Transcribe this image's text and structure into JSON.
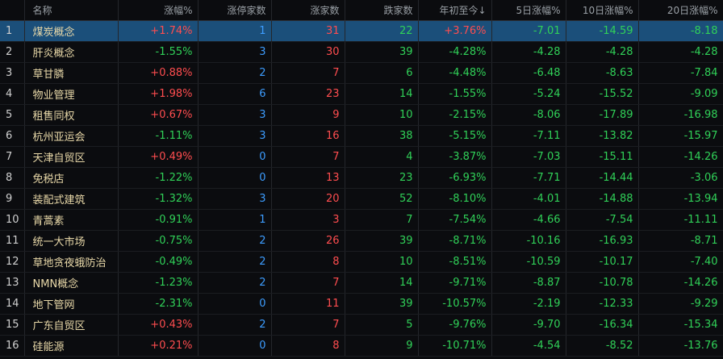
{
  "columns": [
    "",
    "名称",
    "涨幅%",
    "涨停家数",
    "涨家数",
    "跌家数",
    "年初至今↓",
    "5日涨幅%",
    "10日涨幅%",
    "20日涨幅%"
  ],
  "colors": {
    "up": "#ff4d4f",
    "down": "#30d158",
    "limit_up_count": "#3d9dff",
    "name": "#e8d8a8",
    "selected_row_bg": "#1b4f7a"
  },
  "selected_row": 0,
  "rows": [
    {
      "idx": "1",
      "name": "煤炭概念",
      "pct": "+1.74%",
      "limit_up": "1",
      "up_count": "31",
      "down_count": "22",
      "ytd": "+3.76%",
      "d5": "-7.01",
      "d10": "-14.59",
      "d20": "-8.18"
    },
    {
      "idx": "2",
      "name": "肝炎概念",
      "pct": "-1.55%",
      "limit_up": "3",
      "up_count": "30",
      "down_count": "39",
      "ytd": "-4.28%",
      "d5": "-4.28",
      "d10": "-4.28",
      "d20": "-4.28"
    },
    {
      "idx": "3",
      "name": "草甘膦",
      "pct": "+0.88%",
      "limit_up": "2",
      "up_count": "7",
      "down_count": "6",
      "ytd": "-4.48%",
      "d5": "-6.48",
      "d10": "-8.63",
      "d20": "-7.84"
    },
    {
      "idx": "4",
      "name": "物业管理",
      "pct": "+1.98%",
      "limit_up": "6",
      "up_count": "23",
      "down_count": "14",
      "ytd": "-1.55%",
      "d5": "-5.24",
      "d10": "-15.52",
      "d20": "-9.09"
    },
    {
      "idx": "5",
      "name": "租售同权",
      "pct": "+0.67%",
      "limit_up": "3",
      "up_count": "9",
      "down_count": "10",
      "ytd": "-2.15%",
      "d5": "-8.06",
      "d10": "-17.89",
      "d20": "-16.98"
    },
    {
      "idx": "6",
      "name": "杭州亚运会",
      "pct": "-1.11%",
      "limit_up": "3",
      "up_count": "16",
      "down_count": "38",
      "ytd": "-5.15%",
      "d5": "-7.11",
      "d10": "-13.82",
      "d20": "-15.97"
    },
    {
      "idx": "7",
      "name": "天津自贸区",
      "pct": "+0.49%",
      "limit_up": "0",
      "up_count": "7",
      "down_count": "4",
      "ytd": "-3.87%",
      "d5": "-7.03",
      "d10": "-15.11",
      "d20": "-14.26"
    },
    {
      "idx": "8",
      "name": "免税店",
      "pct": "-1.22%",
      "limit_up": "0",
      "up_count": "13",
      "down_count": "23",
      "ytd": "-6.93%",
      "d5": "-7.71",
      "d10": "-14.44",
      "d20": "-3.06"
    },
    {
      "idx": "9",
      "name": "装配式建筑",
      "pct": "-1.32%",
      "limit_up": "3",
      "up_count": "20",
      "down_count": "52",
      "ytd": "-8.10%",
      "d5": "-4.01",
      "d10": "-14.88",
      "d20": "-13.94"
    },
    {
      "idx": "10",
      "name": "青蒿素",
      "pct": "-0.91%",
      "limit_up": "1",
      "up_count": "3",
      "down_count": "7",
      "ytd": "-7.54%",
      "d5": "-4.66",
      "d10": "-7.54",
      "d20": "-11.11"
    },
    {
      "idx": "11",
      "name": "统一大市场",
      "pct": "-0.75%",
      "limit_up": "2",
      "up_count": "26",
      "down_count": "39",
      "ytd": "-8.71%",
      "d5": "-10.16",
      "d10": "-16.93",
      "d20": "-8.71"
    },
    {
      "idx": "12",
      "name": "草地贪夜蛾防治",
      "pct": "-0.49%",
      "limit_up": "2",
      "up_count": "8",
      "down_count": "10",
      "ytd": "-8.51%",
      "d5": "-10.59",
      "d10": "-10.17",
      "d20": "-7.40"
    },
    {
      "idx": "13",
      "name": "NMN概念",
      "pct": "-1.23%",
      "limit_up": "2",
      "up_count": "7",
      "down_count": "14",
      "ytd": "-9.71%",
      "d5": "-8.87",
      "d10": "-10.78",
      "d20": "-14.26"
    },
    {
      "idx": "14",
      "name": "地下管网",
      "pct": "-2.31%",
      "limit_up": "0",
      "up_count": "11",
      "down_count": "39",
      "ytd": "-10.57%",
      "d5": "-2.19",
      "d10": "-12.33",
      "d20": "-9.29"
    },
    {
      "idx": "15",
      "name": "广东自贸区",
      "pct": "+0.43%",
      "limit_up": "2",
      "up_count": "7",
      "down_count": "5",
      "ytd": "-9.76%",
      "d5": "-9.70",
      "d10": "-16.34",
      "d20": "-15.34"
    },
    {
      "idx": "16",
      "name": "硅能源",
      "pct": "+0.21%",
      "limit_up": "0",
      "up_count": "8",
      "down_count": "9",
      "ytd": "-10.71%",
      "d5": "-4.54",
      "d10": "-8.52",
      "d20": "-13.76"
    }
  ]
}
